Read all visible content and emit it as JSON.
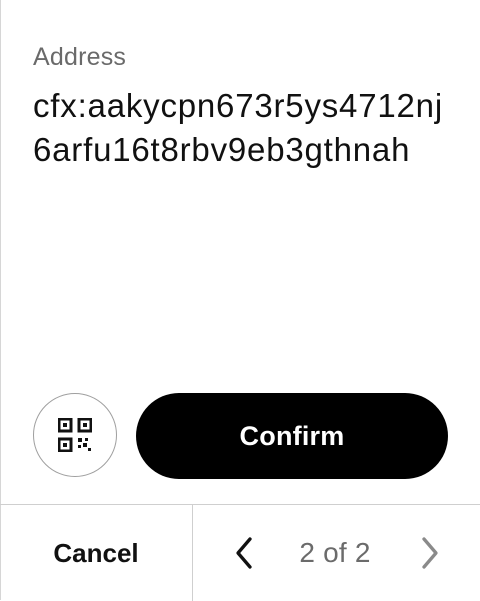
{
  "address": {
    "label": "Address",
    "value": "cfx:aakycpn673r5ys4712nj6arfu16t8rbv9eb3gthnah"
  },
  "actions": {
    "qr_icon": "qr-code-icon",
    "confirm_label": "Confirm"
  },
  "footer": {
    "cancel_label": "Cancel",
    "page_indicator": "2 of 2",
    "prev_icon": "chevron-left-icon",
    "next_icon": "chevron-right-icon"
  },
  "colors": {
    "primary_button": "#000000",
    "primary_button_text": "#ffffff",
    "muted_text": "#6a6a6a",
    "border": "#cfcfcf"
  }
}
